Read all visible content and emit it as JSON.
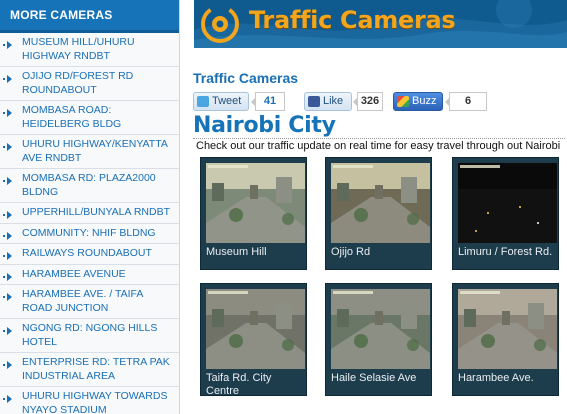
{
  "sidebar": {
    "header": "MORE CAMERAS",
    "items": [
      {
        "label": "MUSEUM HILL/UHURU HIGHWAY RNDBT"
      },
      {
        "label": "OJIJO RD/FOREST RD ROUNDABOUT"
      },
      {
        "label": "MOMBASA ROAD: HEIDELBERG BLDG"
      },
      {
        "label": "UHURU HIGHWAY/KENYATTA AVE RNDBT"
      },
      {
        "label": "MOMBASA RD: PLAZA2000 BLDNG"
      },
      {
        "label": "UPPERHILL/BUNYALA RNDBT"
      },
      {
        "label": "COMMUNITY: NHIF BLDNG"
      },
      {
        "label": "RAILWAYS ROUNDABOUT"
      },
      {
        "label": "HARAMBEE AVENUE"
      },
      {
        "label": "HARAMBEE AVE. / TAIFA ROAD JUNCTION"
      },
      {
        "label": "NGONG RD: NGONG HILLS HOTEL"
      },
      {
        "label": "ENTERPRISE RD: TETRA PAK INDUSTRIAL AREA"
      },
      {
        "label": "UHURU HIGHWAY TOWARDS NYAYO STADIUM"
      }
    ]
  },
  "banner": {
    "title": "Traffic Cameras",
    "brand_color": "#f2a51d",
    "bg_color": "#0f5a8f"
  },
  "content": {
    "section_heading": "Traffic Cameras",
    "social": {
      "tweet_label": "Tweet",
      "tweet_count": "41",
      "like_label": "Like",
      "like_count": "326",
      "buzz_label": "Buzz",
      "buzz_count": "6"
    },
    "page_title": "Nairobi City",
    "intro": "Check out our traffic update on real time for easy travel through out Nairobi"
  },
  "cameras": [
    {
      "label": "Museum Hill",
      "sky": "#c9c9b0",
      "ground": "#7d8a78"
    },
    {
      "label": "Ojijo Rd",
      "sky": "#c4c0a0",
      "ground": "#6e6a56"
    },
    {
      "label": "Limuru / Forest Rd.",
      "sky": "#0a0a0a",
      "ground": "#111111"
    },
    {
      "label": "Taifa Rd. City Centre",
      "sky": "#8c8c80",
      "ground": "#707268"
    },
    {
      "label": "Haile Selasie Ave",
      "sky": "#8d8f84",
      "ground": "#6b7766"
    },
    {
      "label": "Harambee Ave.",
      "sky": "#b0a898",
      "ground": "#8a8478"
    }
  ]
}
